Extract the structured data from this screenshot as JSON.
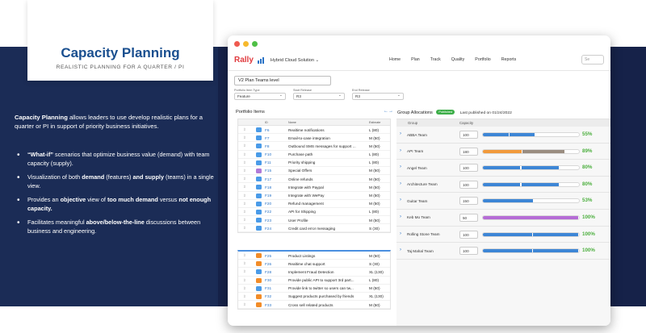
{
  "slide": {
    "title": "Capacity Planning",
    "subtitle": "REALISTIC PLANNING FOR A QUARTER / PI",
    "intro_bold": "Capacity Planning",
    "intro_rest": " allows leaders to use develop realistic plans for a quarter or PI in support of priority business initiatives.",
    "bullets": [
      [
        {
          "t": "“What-if”",
          "b": true
        },
        {
          "t": " scenarios that optimize business value (demand) with team capacity (supply)."
        }
      ],
      [
        {
          "t": "Visualization of both "
        },
        {
          "t": "demand",
          "b": true
        },
        {
          "t": " (features) "
        },
        {
          "t": "and supply",
          "b": true
        },
        {
          "t": " (teams) in a single view."
        }
      ],
      [
        {
          "t": "Provides an "
        },
        {
          "t": "objective",
          "b": true
        },
        {
          "t": " view of "
        },
        {
          "t": "too much demand",
          "b": true
        },
        {
          "t": " versus "
        },
        {
          "t": "not enough capacity.",
          "b": true
        }
      ],
      [
        {
          "t": "Facilitates meaningful "
        },
        {
          "t": "above/below-the-line",
          "b": true
        },
        {
          "t": " discussions between business and engineering."
        }
      ]
    ]
  },
  "colors": {
    "band": "#1b2c56",
    "rally_red": "#e03a3e",
    "link_blue": "#2a73c6",
    "feature_badge": "#4a9be8",
    "special_badge": "#b07ad8",
    "high_badge": "#f28c28",
    "bar_blue": "#3d86d6",
    "bar_orange": "#f29a3b",
    "bar_brown": "#9a8d80",
    "bar_purple": "#b56cd6",
    "pct_green": "#4caf3e",
    "pct_orange": "#f29a3b"
  },
  "app": {
    "logo": "Rally",
    "solution": "Hybrid Cloud Solution ⌄",
    "nav": [
      "Home",
      "Plan",
      "Track",
      "Quality",
      "Portfolio",
      "Reports"
    ],
    "search_placeholder": "Se",
    "plan_name": "V2 Plan Teams level",
    "filters": [
      {
        "label": "Portfolio Item Type",
        "value": "Feature"
      },
      {
        "label": "Start Release",
        "value": "R3"
      },
      {
        "label": "End Release",
        "value": "R3"
      }
    ]
  },
  "portfolio": {
    "title": "Portfolio Items",
    "arrows": "←→",
    "headers": {
      "id": "ID",
      "name": "Name",
      "estimate": "Estimate"
    },
    "items": [
      {
        "id": "F6",
        "name": "Realtime notifications",
        "est": "L (80)",
        "badge": "feature"
      },
      {
        "id": "F7",
        "name": "Email-to-case integration",
        "est": "M (50)",
        "badge": "feature"
      },
      {
        "id": "F8",
        "name": "Outbound SMS messages for support ...",
        "est": "M (50)",
        "badge": "feature"
      },
      {
        "id": "F10",
        "name": "Purchase path",
        "est": "L (80)",
        "badge": "feature"
      },
      {
        "id": "F11",
        "name": "Priority shipping",
        "est": "L (80)",
        "badge": "feature"
      },
      {
        "id": "F15",
        "name": "Special Offers",
        "est": "M (50)",
        "badge": "special"
      },
      {
        "id": "F17",
        "name": "Online refunds",
        "est": "M (50)",
        "badge": "feature"
      },
      {
        "id": "F18",
        "name": "Integrate with Paypal",
        "est": "M (50)",
        "badge": "feature"
      },
      {
        "id": "F19",
        "name": "Integrate with WePay",
        "est": "M (50)",
        "badge": "feature"
      },
      {
        "id": "F20",
        "name": "Refund management",
        "est": "M (50)",
        "badge": "feature"
      },
      {
        "id": "F22",
        "name": "API for Shipping",
        "est": "L (80)",
        "badge": "feature"
      },
      {
        "id": "F23",
        "name": "User Profile",
        "est": "M (50)",
        "badge": "feature"
      },
      {
        "id": "F24",
        "name": "Credit card error messaging",
        "est": "S (30)",
        "badge": "feature"
      }
    ],
    "below": [
      {
        "id": "F25",
        "name": "Product Listings",
        "est": "M (50)",
        "badge": "high"
      },
      {
        "id": "F26",
        "name": "Realtime chat support",
        "est": "S (30)",
        "badge": "high"
      },
      {
        "id": "F28",
        "name": "Implement Fraud Detection",
        "est": "XL (130)",
        "badge": "feature"
      },
      {
        "id": "F30",
        "name": "Provide public API to support 3rd part...",
        "est": "L (80)",
        "badge": "high"
      },
      {
        "id": "F31",
        "name": "Provide link to twitter so users can tw...",
        "est": "M (50)",
        "badge": "feature"
      },
      {
        "id": "F32",
        "name": "Suggest products purchased by friends",
        "est": "XL (130)",
        "badge": "high"
      },
      {
        "id": "F33",
        "name": "Cross sell related products",
        "est": "M (50)",
        "badge": "high"
      }
    ]
  },
  "allocations": {
    "title": "Group Allocations",
    "status": "Published",
    "published": "Last published on 01/24/2022",
    "headers": {
      "group": "Group",
      "capacity": "Capacity"
    },
    "groups": [
      {
        "name": "ABBA Team",
        "capacity": "100",
        "pct": "55%",
        "segments": [
          [
            0.28,
            "blue"
          ],
          [
            0.27,
            "blue"
          ]
        ],
        "pct_color": "pct_green"
      },
      {
        "name": "API Team",
        "capacity": "180",
        "pct": "89%",
        "segments": [
          [
            0.41,
            "orange"
          ],
          [
            0.45,
            "brown"
          ]
        ],
        "pct_color": "pct_green"
      },
      {
        "name": "Angel Team",
        "capacity": "100",
        "pct": "80%",
        "segments": [
          [
            0.4,
            "blue"
          ],
          [
            0.4,
            "blue"
          ]
        ],
        "pct_color": "pct_green"
      },
      {
        "name": "Architecture Team",
        "capacity": "100",
        "pct": "80%",
        "segments": [
          [
            0.4,
            "blue"
          ],
          [
            0.4,
            "blue"
          ]
        ],
        "pct_color": "pct_green"
      },
      {
        "name": "Guitar Team",
        "capacity": "150",
        "pct": "53%",
        "segments": [
          [
            0.53,
            "blue"
          ]
        ],
        "pct_color": "pct_green"
      },
      {
        "name": "Keb Mo Team",
        "capacity": "50",
        "pct": "100%",
        "segments": [
          [
            1.0,
            "purple"
          ]
        ],
        "pct_color": "pct_green"
      },
      {
        "name": "Rolling Stone Team",
        "capacity": "100",
        "pct": "100%",
        "segments": [
          [
            0.52,
            "blue"
          ],
          [
            0.48,
            "blue"
          ]
        ],
        "pct_color": "pct_green"
      },
      {
        "name": "Taj Mahal Team",
        "capacity": "100",
        "pct": "100%",
        "segments": [
          [
            0.52,
            "blue"
          ],
          [
            0.48,
            "blue"
          ]
        ],
        "pct_color": "pct_green"
      }
    ]
  }
}
